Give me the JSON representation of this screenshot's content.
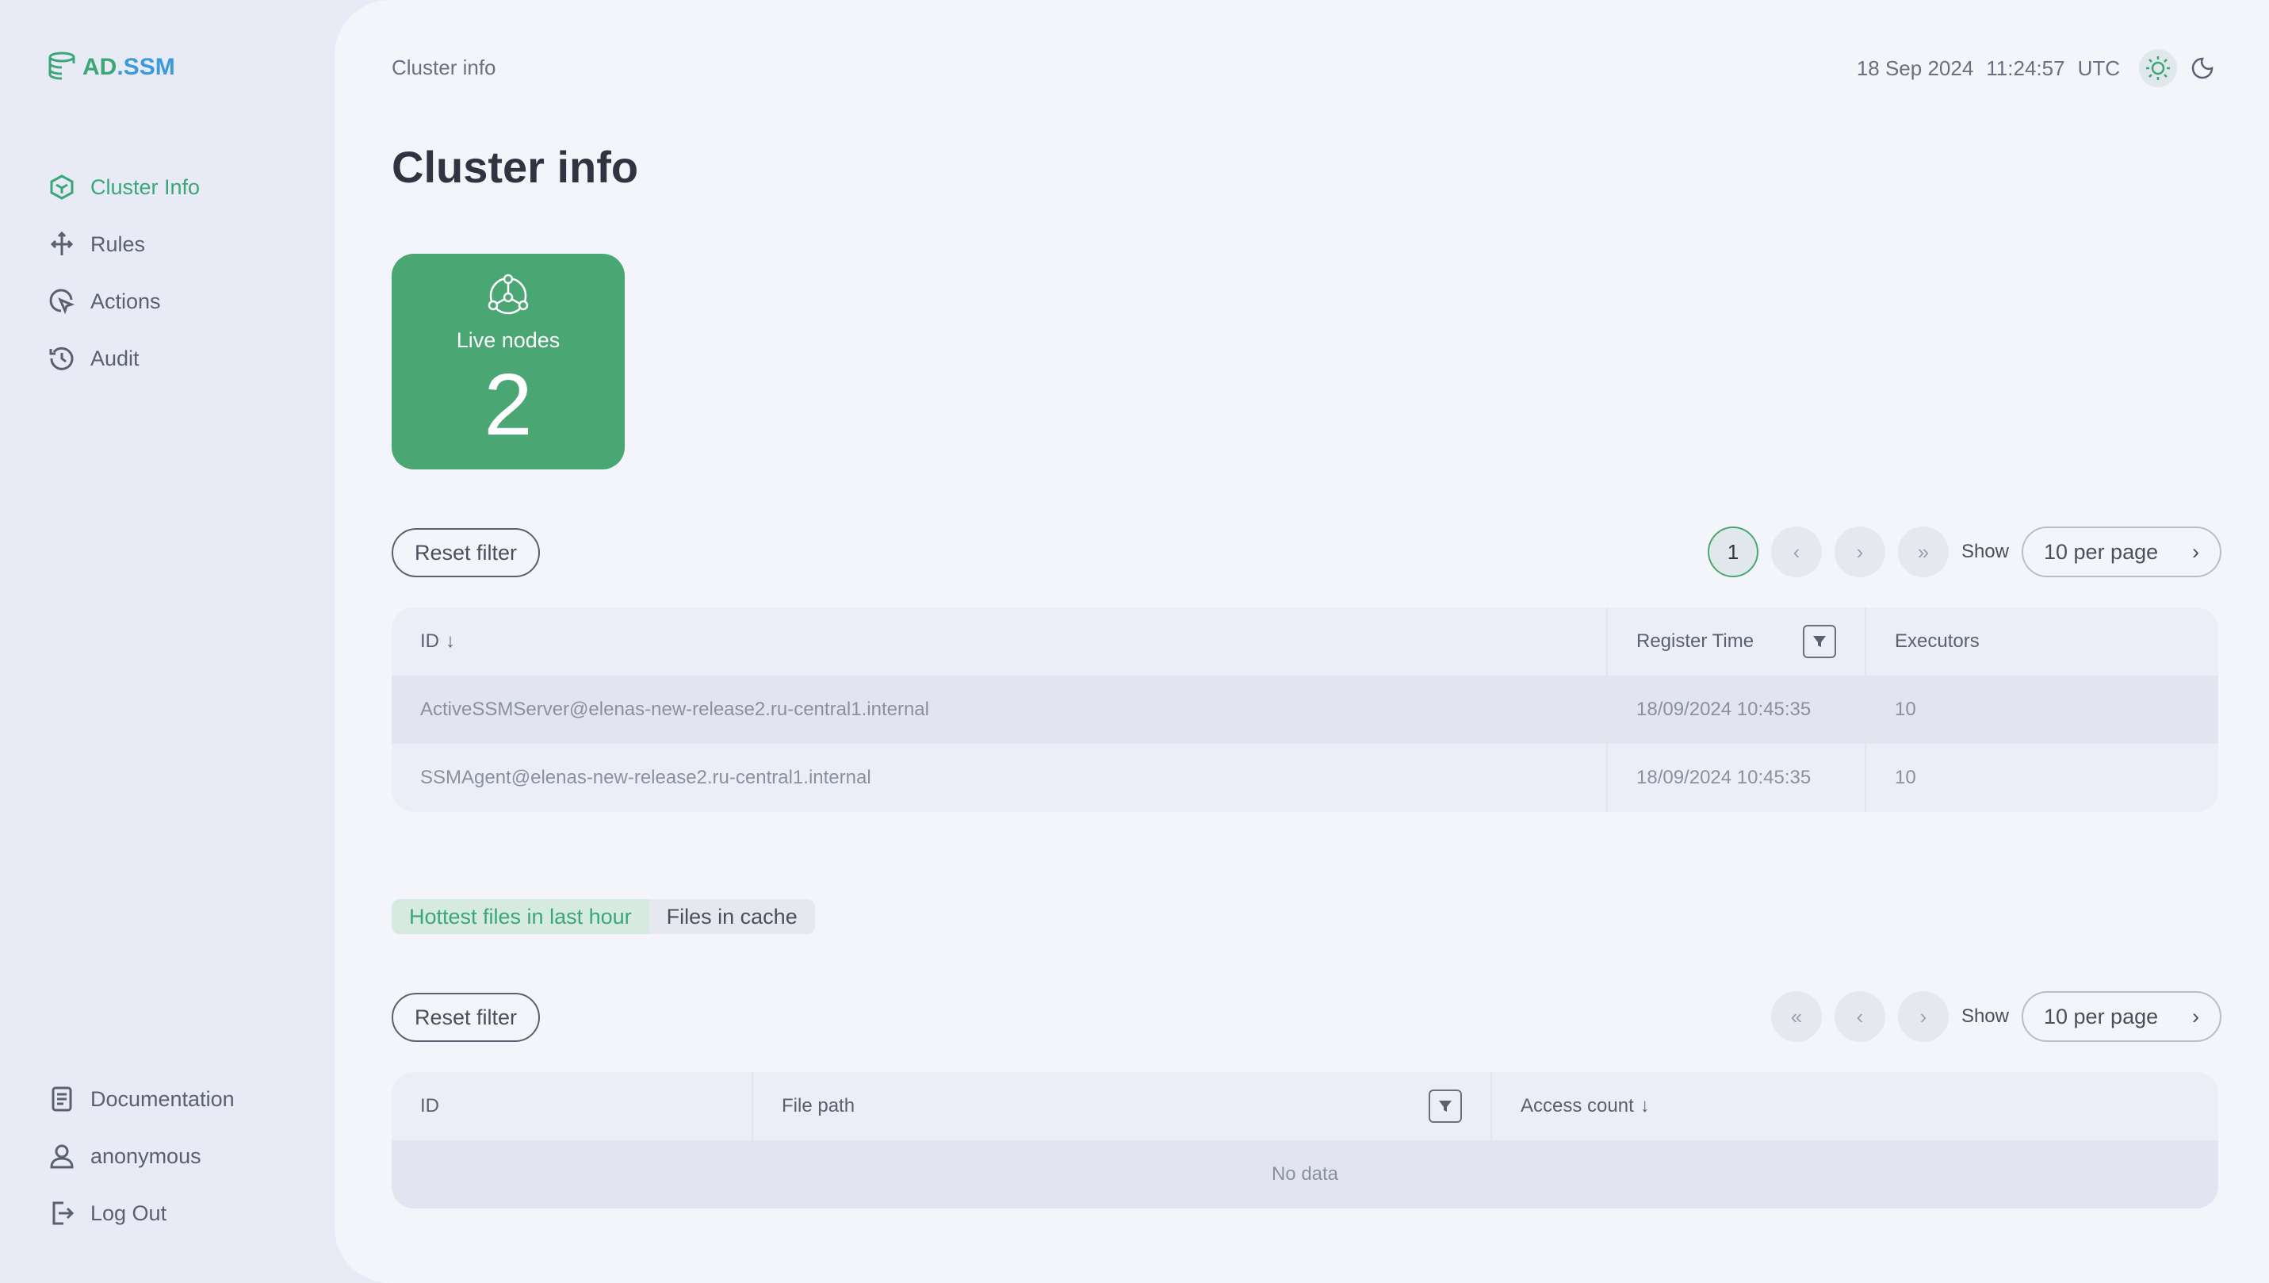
{
  "app": {
    "logo_text_ad": "AD",
    "logo_text_rest": ".SSM"
  },
  "sidebar": {
    "items": [
      {
        "label": "Cluster Info",
        "icon": "hexagon-cube-icon",
        "active": true
      },
      {
        "label": "Rules",
        "icon": "rules-arrows-icon"
      },
      {
        "label": "Actions",
        "icon": "cursor-click-icon"
      },
      {
        "label": "Audit",
        "icon": "history-icon"
      }
    ],
    "bottom": [
      {
        "label": "Documentation",
        "icon": "document-icon"
      },
      {
        "label": "anonymous",
        "icon": "user-icon"
      },
      {
        "label": "Log Out",
        "icon": "logout-icon"
      }
    ]
  },
  "header": {
    "breadcrumb": "Cluster info",
    "date": "18 Sep 2024",
    "time": "11:24:57",
    "timezone": "UTC"
  },
  "page": {
    "title": "Cluster info"
  },
  "tile": {
    "label": "Live nodes",
    "value": "2",
    "color": "#4aa673"
  },
  "nodes": {
    "reset_label": "Reset filter",
    "pager": {
      "current": "1",
      "show_label": "Show",
      "per_page": "10 per page"
    },
    "columns": [
      "ID",
      "Register Time",
      "Executors"
    ],
    "rows": [
      {
        "id": "ActiveSSMServer@elenas-new-release2.ru-central1.internal",
        "time": "18/09/2024 10:45:35",
        "executors": "10"
      },
      {
        "id": "SSMAgent@elenas-new-release2.ru-central1.internal",
        "time": "18/09/2024 10:45:35",
        "executors": "10"
      }
    ]
  },
  "files": {
    "tabs": [
      "Hottest files in last hour",
      "Files in cache"
    ],
    "reset_label": "Reset filter",
    "pager": {
      "show_label": "Show",
      "per_page": "10 per page"
    },
    "columns": [
      "ID",
      "File path",
      "Access count"
    ],
    "empty": "No data"
  }
}
